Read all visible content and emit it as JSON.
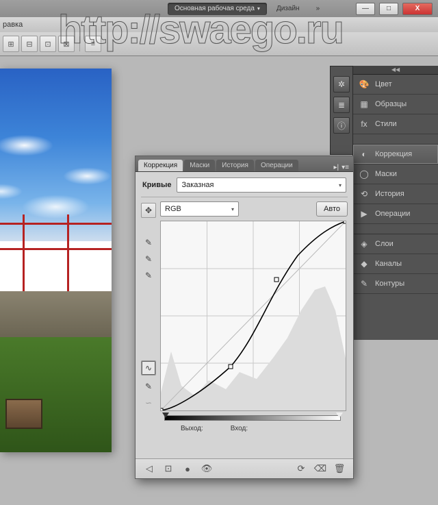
{
  "titlebar": {
    "workspace_active": "Основная рабочая среда",
    "workspace_other": "Дизайн",
    "chev": "»"
  },
  "window_controls": {
    "min": "—",
    "max": "□",
    "close": "X"
  },
  "menubar": {
    "item": "равка"
  },
  "watermark": "http://swaego.ru",
  "toolbar_icons": [
    "⊞",
    "⊟",
    "⊡",
    "⊠",
    "≡"
  ],
  "iconstrip": [
    "✲",
    "≣",
    "ⓘ"
  ],
  "right_panel": {
    "groups": [
      {
        "rows": [
          {
            "icon": "🎨",
            "label": "Цвет"
          },
          {
            "icon": "▦",
            "label": "Образцы"
          },
          {
            "icon": "fx",
            "label": "Стили"
          }
        ]
      },
      {
        "rows": [
          {
            "icon": "◐",
            "label": "Коррекция",
            "selected": true
          },
          {
            "icon": "◯",
            "label": "Маски"
          },
          {
            "icon": "⟲",
            "label": "История"
          },
          {
            "icon": "▶",
            "label": "Операции"
          }
        ]
      },
      {
        "rows": [
          {
            "icon": "◈",
            "label": "Слои"
          },
          {
            "icon": "◆",
            "label": "Каналы"
          },
          {
            "icon": "✎",
            "label": "Контуры"
          }
        ]
      }
    ]
  },
  "adjust": {
    "tabs": [
      "Коррекция",
      "Маски",
      "История",
      "Операции"
    ],
    "active_tab": 0,
    "tail": [
      "▸|",
      "▾≡"
    ],
    "type_label": "Кривые",
    "preset": "Заказная",
    "channel": "RGB",
    "auto": "Авто",
    "output_label": "Выход:",
    "input_label": "Вход:",
    "footer_icons_left": [
      "◁",
      "⊡",
      "●",
      "👁"
    ],
    "footer_icons_right": [
      "⟳",
      "⌫",
      "🗑"
    ]
  },
  "chart_data": {
    "type": "line",
    "title": "Кривые (Curves) — RGB",
    "xlabel": "Вход",
    "ylabel": "Выход",
    "xlim": [
      0,
      255
    ],
    "ylim": [
      0,
      255
    ],
    "grid": true,
    "series": [
      {
        "name": "baseline",
        "x": [
          0,
          255
        ],
        "y": [
          0,
          255
        ]
      },
      {
        "name": "curve",
        "x": [
          0,
          16,
          96,
          160,
          238,
          255
        ],
        "y": [
          0,
          4,
          60,
          180,
          252,
          255
        ]
      }
    ],
    "control_points": [
      {
        "x": 0,
        "y": 0
      },
      {
        "x": 96,
        "y": 60
      },
      {
        "x": 160,
        "y": 180
      },
      {
        "x": 255,
        "y": 255
      }
    ],
    "histogram_peaks_x": [
      15,
      60,
      110,
      170,
      205,
      235
    ],
    "histogram_peaks_y": [
      90,
      40,
      55,
      80,
      140,
      175
    ]
  }
}
